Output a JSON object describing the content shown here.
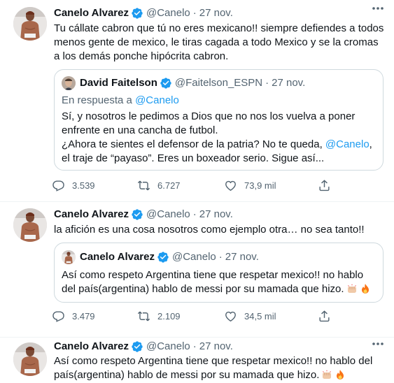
{
  "tweets": [
    {
      "author_name": "Canelo Alvarez",
      "handle": "@Canelo",
      "separator": "·",
      "date": "27 nov.",
      "text": "Tu cállate cabron que tú no eres mexicano!! siempre defiendes a todos menos gente de mexico, le tiras cagada a todo Mexico y se la cromas a los demás ponche hipócrita cabron.",
      "quote": {
        "author_name": "David Faitelson",
        "handle": "@Faitelson_ESPN",
        "separator": "·",
        "date": "27 nov.",
        "reply_prefix": "En respuesta a",
        "reply_mention": "@Canelo",
        "text_1": "Sí, y nosotros le pedimos a Dios que no nos los vuelva a poner enfrente en una cancha de futbol.",
        "text_2_before": "¿Ahora te sientes el defensor de la patria? No te queda, ",
        "text_2_mention": "@Canelo",
        "text_2_after": ", el traje de “payaso”. Eres un boxeador serio. Sigue así..."
      },
      "replies": "3.539",
      "retweets": "6.727",
      "likes": "73,9 mil"
    },
    {
      "author_name": "Canelo Alvarez",
      "handle": "@Canelo",
      "separator": "·",
      "date": "27 nov.",
      "text": "la afición es una cosa nosotros como ejemplo otra… no sea tanto!!",
      "quote": {
        "author_name": "Canelo Alvarez",
        "handle": "@Canelo",
        "separator": "·",
        "date": "27 nov.",
        "text": "Así como respeto Argentina tiene que respetar mexico!! no hablo del país(argentina) hablo de messi por su mamada que hizo."
      },
      "replies": "3.479",
      "retweets": "2.109",
      "likes": "34,5 mil"
    },
    {
      "author_name": "Canelo Alvarez",
      "handle": "@Canelo",
      "separator": "·",
      "date": "27 nov.",
      "text": "Así como respeto Argentina tiene que respetar mexico!! no hablo del país(argentina) hablo de messi por su mamada que hizo."
    }
  ],
  "icons": {
    "verified": "verified-badge-icon",
    "more": "more-icon",
    "reply": "reply-icon",
    "retweet": "retweet-icon",
    "like": "like-icon",
    "share": "share-icon",
    "fist": "fist-emoji-icon",
    "fire": "fire-emoji-icon"
  },
  "colors": {
    "accent": "#1d9bf0",
    "text": "#0f1419",
    "secondary": "#536471",
    "border": "#cfd9de"
  }
}
